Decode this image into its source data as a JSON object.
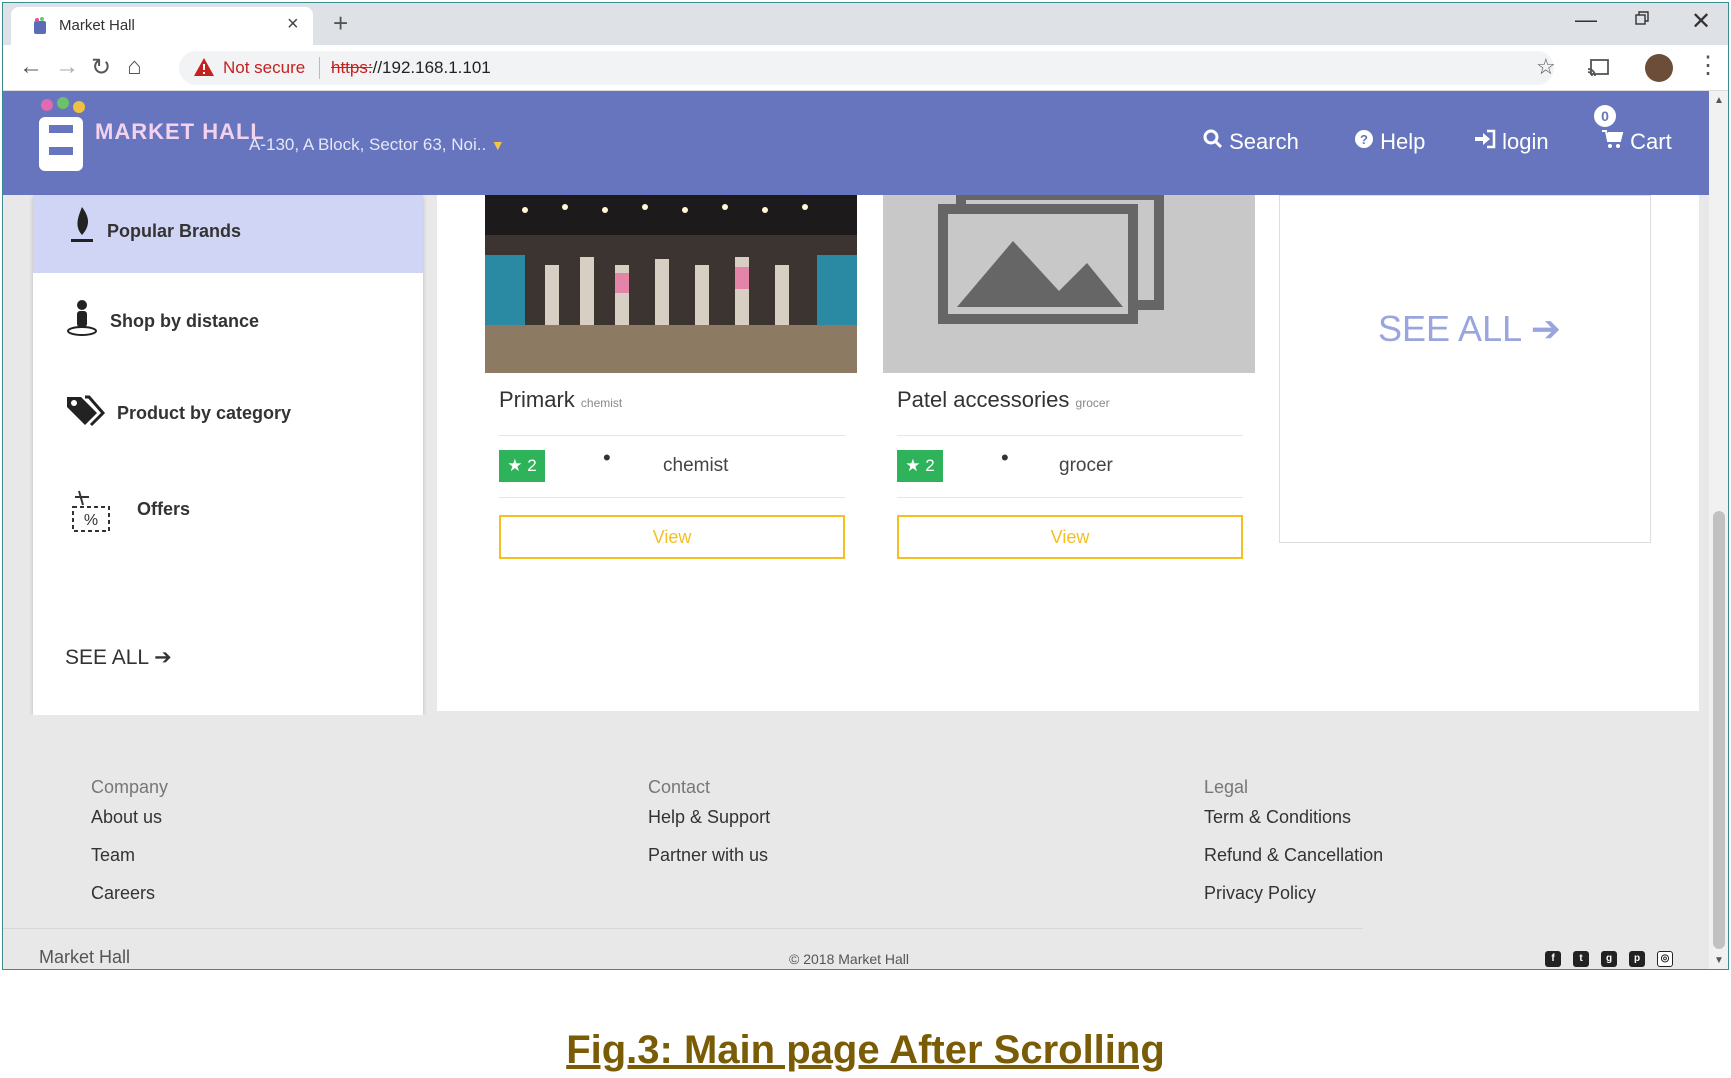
{
  "browser": {
    "tab_title": "Market Hall",
    "tab_close": "×",
    "new_tab": "+",
    "not_secure": "Not secure",
    "url_scheme": "https:",
    "url_rest": "//192.168.1.101"
  },
  "header": {
    "brand": "MARKET HALL",
    "address": "A-130, A Block, Sector 63, Noi..",
    "nav": [
      {
        "label": "Search",
        "icon": "search-icon"
      },
      {
        "label": "Help",
        "icon": "help-icon"
      },
      {
        "label": "login",
        "icon": "login-icon"
      },
      {
        "label": "Cart",
        "icon": "cart-icon"
      }
    ],
    "cart_count": "0"
  },
  "sidebar": {
    "items": [
      {
        "label": "Popular Brands",
        "icon": "flame-icon",
        "active": true
      },
      {
        "label": "Shop by distance",
        "icon": "person-location-icon"
      },
      {
        "label": "Product by category",
        "icon": "tags-icon"
      },
      {
        "label": "Offers",
        "icon": "discount-icon"
      }
    ],
    "see_all": "SEE ALL"
  },
  "shops": [
    {
      "name": "Primark",
      "category_tag": "chemist",
      "rating": "2",
      "category": "chemist",
      "view_label": "View"
    },
    {
      "name": "Patel accessories",
      "category_tag": "grocer",
      "rating": "2",
      "category": "grocer",
      "view_label": "View"
    }
  ],
  "see_all_card": "SEE ALL",
  "footer": {
    "columns": [
      {
        "heading": "Company",
        "links": [
          "About us",
          "Team",
          "Careers"
        ]
      },
      {
        "heading": "Contact",
        "links": [
          "Help & Support",
          "Partner with us"
        ]
      },
      {
        "heading": "Legal",
        "links": [
          "Term & Conditions",
          "Refund & Cancellation",
          "Privacy Policy"
        ]
      }
    ],
    "brand": "Market Hall",
    "copyright": "© 2018 Market Hall",
    "social": [
      "facebook-icon",
      "twitter-icon",
      "google-plus-icon",
      "pinterest-icon",
      "instagram-icon"
    ]
  },
  "caption": "Fig.3: Main page After Scrolling",
  "colors": {
    "header_bg": "#6675be",
    "sidebar_active": "#d0d5f5",
    "rating_green": "#2fb35a",
    "view_border": "#f4c020",
    "caption": "#7a5c06"
  }
}
